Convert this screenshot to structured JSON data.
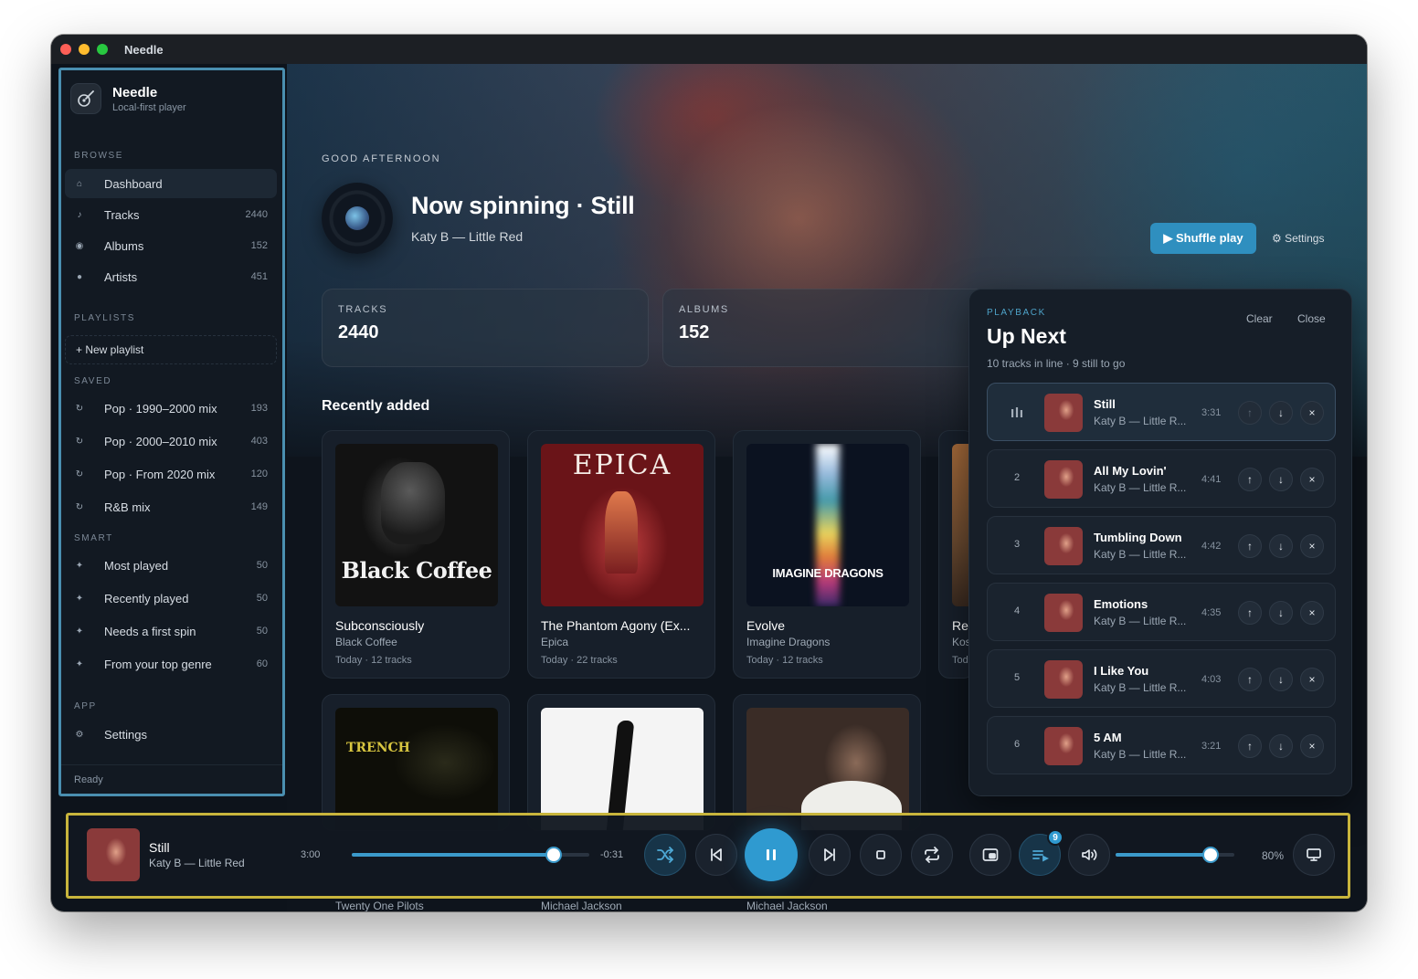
{
  "window": {
    "title": "Needle"
  },
  "sidebar": {
    "brand": {
      "name": "Needle",
      "subtitle": "Local-first player"
    },
    "browse_label": "BROWSE",
    "browse": [
      {
        "label": "Dashboard",
        "icon": "home-icon",
        "count": ""
      },
      {
        "label": "Tracks",
        "icon": "music-note-icon",
        "count": "2440"
      },
      {
        "label": "Albums",
        "icon": "disc-icon",
        "count": "152"
      },
      {
        "label": "Artists",
        "icon": "user-icon",
        "count": "451"
      }
    ],
    "playlists_label": "PLAYLISTS",
    "new_playlist": "+ New playlist",
    "saved_label": "SAVED",
    "saved": [
      {
        "label": "Pop · 1990–2000 mix",
        "count": "193"
      },
      {
        "label": "Pop · 2000–2010 mix",
        "count": "403"
      },
      {
        "label": "Pop · From 2020 mix",
        "count": "120"
      },
      {
        "label": "R&B mix",
        "count": "149"
      }
    ],
    "smart_label": "SMART",
    "smart": [
      {
        "label": "Most played",
        "count": "50"
      },
      {
        "label": "Recently played",
        "count": "50"
      },
      {
        "label": "Needs a first spin",
        "count": "50"
      },
      {
        "label": "From your top genre",
        "count": "60"
      }
    ],
    "app_label": "APP",
    "app": [
      {
        "label": "Settings",
        "count": ""
      }
    ],
    "status": "Ready"
  },
  "hero": {
    "greeting": "GOOD AFTERNOON",
    "now_spinning": "Now spinning · Still",
    "subtitle": "Katy B — Little Red",
    "shuffle_label": "▶ Shuffle play",
    "settings_label": "⚙ Settings"
  },
  "stats": [
    {
      "label": "TRACKS",
      "value": "2440"
    },
    {
      "label": "ALBUMS",
      "value": "152"
    }
  ],
  "recently_added": {
    "title": "Recently added",
    "cards": [
      {
        "title": "Subconsciously",
        "artist": "Black Coffee",
        "meta": "Today · 12 tracks",
        "art_text": "Black Coffee"
      },
      {
        "title": "The Phantom Agony (Ex...",
        "artist": "Epica",
        "meta": "Today · 22 tracks",
        "art_text": "EPICA"
      },
      {
        "title": "Evolve",
        "artist": "Imagine Dragons",
        "meta": "Today · 12 tracks",
        "art_text": "IMAGINE DRAGONS"
      },
      {
        "title": "Re",
        "artist": "Kos",
        "meta": "Tod",
        "art_text": ""
      }
    ],
    "second_row_artists": [
      "Twenty One Pilots",
      "Michael Jackson",
      "Michael Jackson"
    ],
    "second_row_art_text": [
      "TRENCH",
      "",
      ""
    ]
  },
  "queue": {
    "eyebrow": "PLAYBACK",
    "title": "Up Next",
    "subtitle": "10 tracks in line · 9 still to go",
    "clear_label": "Clear",
    "close_label": "Close",
    "items": [
      {
        "num": "",
        "title": "Still",
        "artist": "Katy B — Little R...",
        "duration": "3:31"
      },
      {
        "num": "2",
        "title": "All My Lovin'",
        "artist": "Katy B — Little R...",
        "duration": "4:41"
      },
      {
        "num": "3",
        "title": "Tumbling Down",
        "artist": "Katy B — Little R...",
        "duration": "4:42"
      },
      {
        "num": "4",
        "title": "Emotions",
        "artist": "Katy B — Little R...",
        "duration": "4:35"
      },
      {
        "num": "5",
        "title": "I Like You",
        "artist": "Katy B — Little R...",
        "duration": "4:03"
      },
      {
        "num": "6",
        "title": "5 AM",
        "artist": "Katy B — Little R...",
        "duration": "3:21"
      }
    ]
  },
  "player": {
    "title": "Still",
    "artist": "Katy B — Little Red",
    "elapsed": "3:00",
    "remaining": "-0:31",
    "progress": 0.85,
    "queue_badge": "9",
    "volume_pct": "80%",
    "volume": 0.8
  },
  "colors": {
    "accent": "#2f9ad0",
    "sidebar_outline": "#4a8fb0",
    "player_outline": "#c8b53c"
  }
}
